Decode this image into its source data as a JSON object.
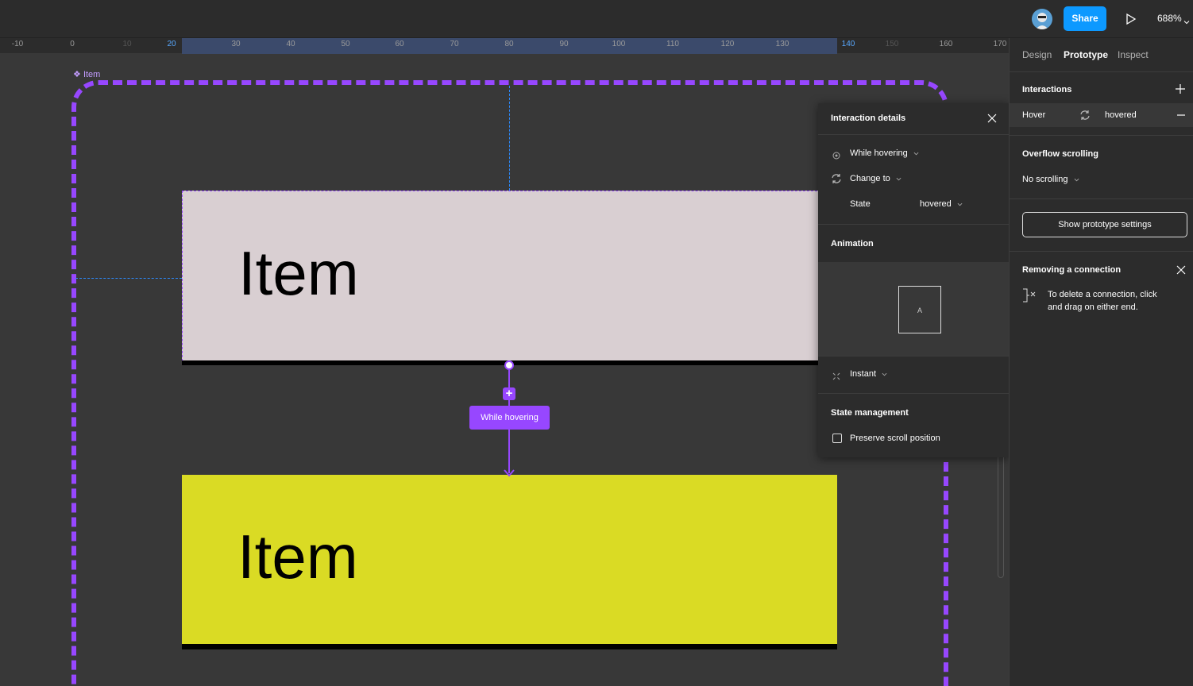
{
  "topbar": {
    "share_label": "Share",
    "zoom": "688%"
  },
  "ruler": {
    "ticks": [
      "-10",
      "0",
      "10",
      "20",
      "30",
      "40",
      "50",
      "60",
      "70",
      "80",
      "90",
      "100",
      "110",
      "120",
      "130",
      "140",
      "150",
      "160",
      "170"
    ]
  },
  "canvas": {
    "frame_label": "Item",
    "card_top_text": "Item",
    "card_bottom_text": "Item",
    "connection_label": "While hovering",
    "colors": {
      "selection": "#9747ff",
      "card_top": "#d9cfd2",
      "card_bottom": "#dadb24"
    }
  },
  "popover": {
    "title": "Interaction details",
    "trigger": "While hovering",
    "action": "Change to",
    "state_label": "State",
    "state_value": "hovered",
    "animation_title": "Animation",
    "preview_letter": "A",
    "animation_type": "Instant",
    "state_management_title": "State management",
    "preserve_scroll": "Preserve scroll position"
  },
  "rightpanel": {
    "tabs": [
      "Design",
      "Prototype",
      "Inspect"
    ],
    "interactions_title": "Interactions",
    "interaction_trigger": "Hover",
    "interaction_target": "hovered",
    "overflow_title": "Overflow scrolling",
    "overflow_value": "No scrolling",
    "prototype_settings_button": "Show prototype settings",
    "tip_title": "Removing a connection",
    "tip_text_line1": "To delete a connection, click",
    "tip_text_line2": "and drag on either end."
  }
}
